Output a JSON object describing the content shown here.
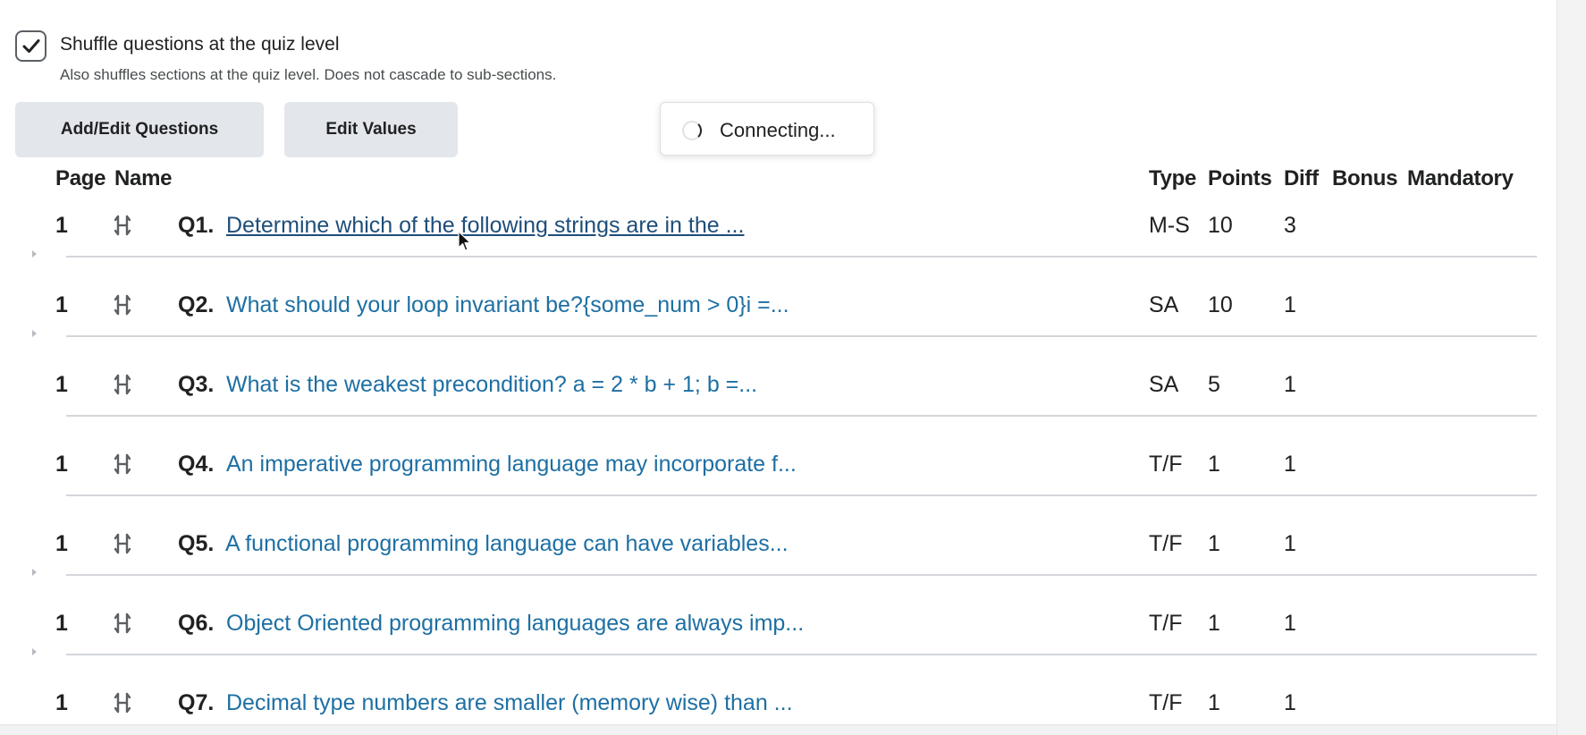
{
  "shuffle": {
    "checked": true,
    "label": "Shuffle questions at the quiz level",
    "help": "Also shuffles sections at the quiz level. Does not cascade to sub-sections."
  },
  "buttons": {
    "add_edit": "Add/Edit Questions",
    "edit_values": "Edit Values"
  },
  "toast": {
    "text": "Connecting..."
  },
  "table": {
    "headers": {
      "page": "Page",
      "name": "Name",
      "type": "Type",
      "points": "Points",
      "diff": "Diff",
      "bonus": "Bonus",
      "mandatory": "Mandatory"
    },
    "rows": [
      {
        "page": "1",
        "num": "Q1.",
        "title": "Determine which of the following strings are in the ...",
        "type": "M-S",
        "points": "10",
        "diff": "3"
      },
      {
        "page": "1",
        "num": "Q2.",
        "title": "What should your loop invariant be?{some_num > 0}i =...",
        "type": "SA",
        "points": "10",
        "diff": "1"
      },
      {
        "page": "1",
        "num": "Q3.",
        "title": "What is the weakest precondition? a = 2 * b + 1; b =...",
        "type": "SA",
        "points": "5",
        "diff": "1"
      },
      {
        "page": "1",
        "num": "Q4.",
        "title": "An imperative programming language may incorporate f...",
        "type": "T/F",
        "points": "1",
        "diff": "1"
      },
      {
        "page": "1",
        "num": "Q5.",
        "title": "A functional programming language can have variables...",
        "type": "T/F",
        "points": "1",
        "diff": "1"
      },
      {
        "page": "1",
        "num": "Q6.",
        "title": "Object Oriented programming languages are always imp...",
        "type": "T/F",
        "points": "1",
        "diff": "1"
      },
      {
        "page": "1",
        "num": "Q7.",
        "title": "Decimal type numbers are smaller (memory wise) than ...",
        "type": "T/F",
        "points": "1",
        "diff": "1"
      }
    ]
  },
  "icons": {
    "checkmark": "check-icon",
    "drag": "drag-handle-icon",
    "spinner": "spinner-icon",
    "cursor": "mouse-pointer-icon",
    "expand": "caret-right-icon"
  },
  "colors": {
    "link": "#1d6fa3",
    "button_bg": "#e3e6ea"
  }
}
